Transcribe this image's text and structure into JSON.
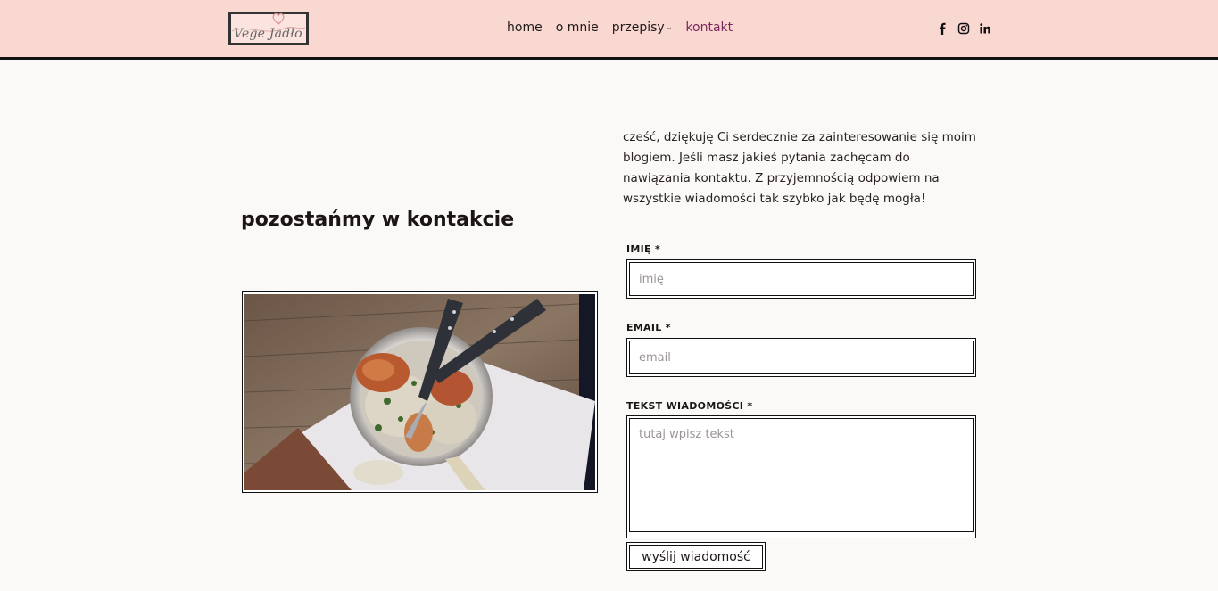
{
  "header": {
    "logo_text": "Vege Jadło",
    "nav": [
      {
        "label": "home"
      },
      {
        "label": "o mnie"
      },
      {
        "label": "przepisy"
      },
      {
        "label": "kontakt"
      }
    ],
    "social_icons": [
      "facebook-icon",
      "instagram-icon",
      "linkedin-icon"
    ],
    "accent_color": "#fad8d2",
    "active_color": "#7a2a5c"
  },
  "left": {
    "title": "pozostańmy w kontakcie"
  },
  "right": {
    "intro": "cześć, dziękuję Ci serdecznie za zainteresowanie się moim blogiem. Jeśli masz jakieś pytania zachęcam do nawiązania kontaktu. Z przyjemnością odpowiem na wszystkie wiadomości tak szybko jak będę mogła!",
    "form": {
      "name_label": "IMIĘ *",
      "name_placeholder": "imię",
      "email_label": "EMAIL *",
      "email_placeholder": "email",
      "message_label": "TEKST WIADOMOŚCI *",
      "message_placeholder": "tutaj wpisz tekst",
      "submit_label": "wyślij wiadomość"
    }
  }
}
